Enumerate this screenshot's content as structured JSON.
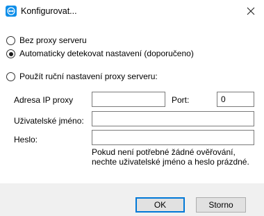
{
  "window": {
    "title": "Konfigurovat..."
  },
  "options": [
    {
      "label": "Bez proxy serveru",
      "checked": false
    },
    {
      "label": "Automaticky detekovat nastavení (doporučeno)",
      "checked": true
    },
    {
      "label": "Použít ruční nastavení proxy serveru:",
      "checked": false
    }
  ],
  "fields": {
    "address_label": "Adresa IP proxy",
    "address_value": "",
    "port_label": "Port:",
    "port_value": "0",
    "username_label": "Uživatelské jméno:",
    "username_value": "",
    "password_label": "Heslo:",
    "password_value": ""
  },
  "note": "Pokud není potřebné žádné ověřování, nechte uživatelské jméno a heslo prázdné.",
  "buttons": {
    "ok": "OK",
    "cancel": "Storno"
  },
  "colors": {
    "brand": "#0e8ee9",
    "default_button_border": "#0078d7"
  }
}
